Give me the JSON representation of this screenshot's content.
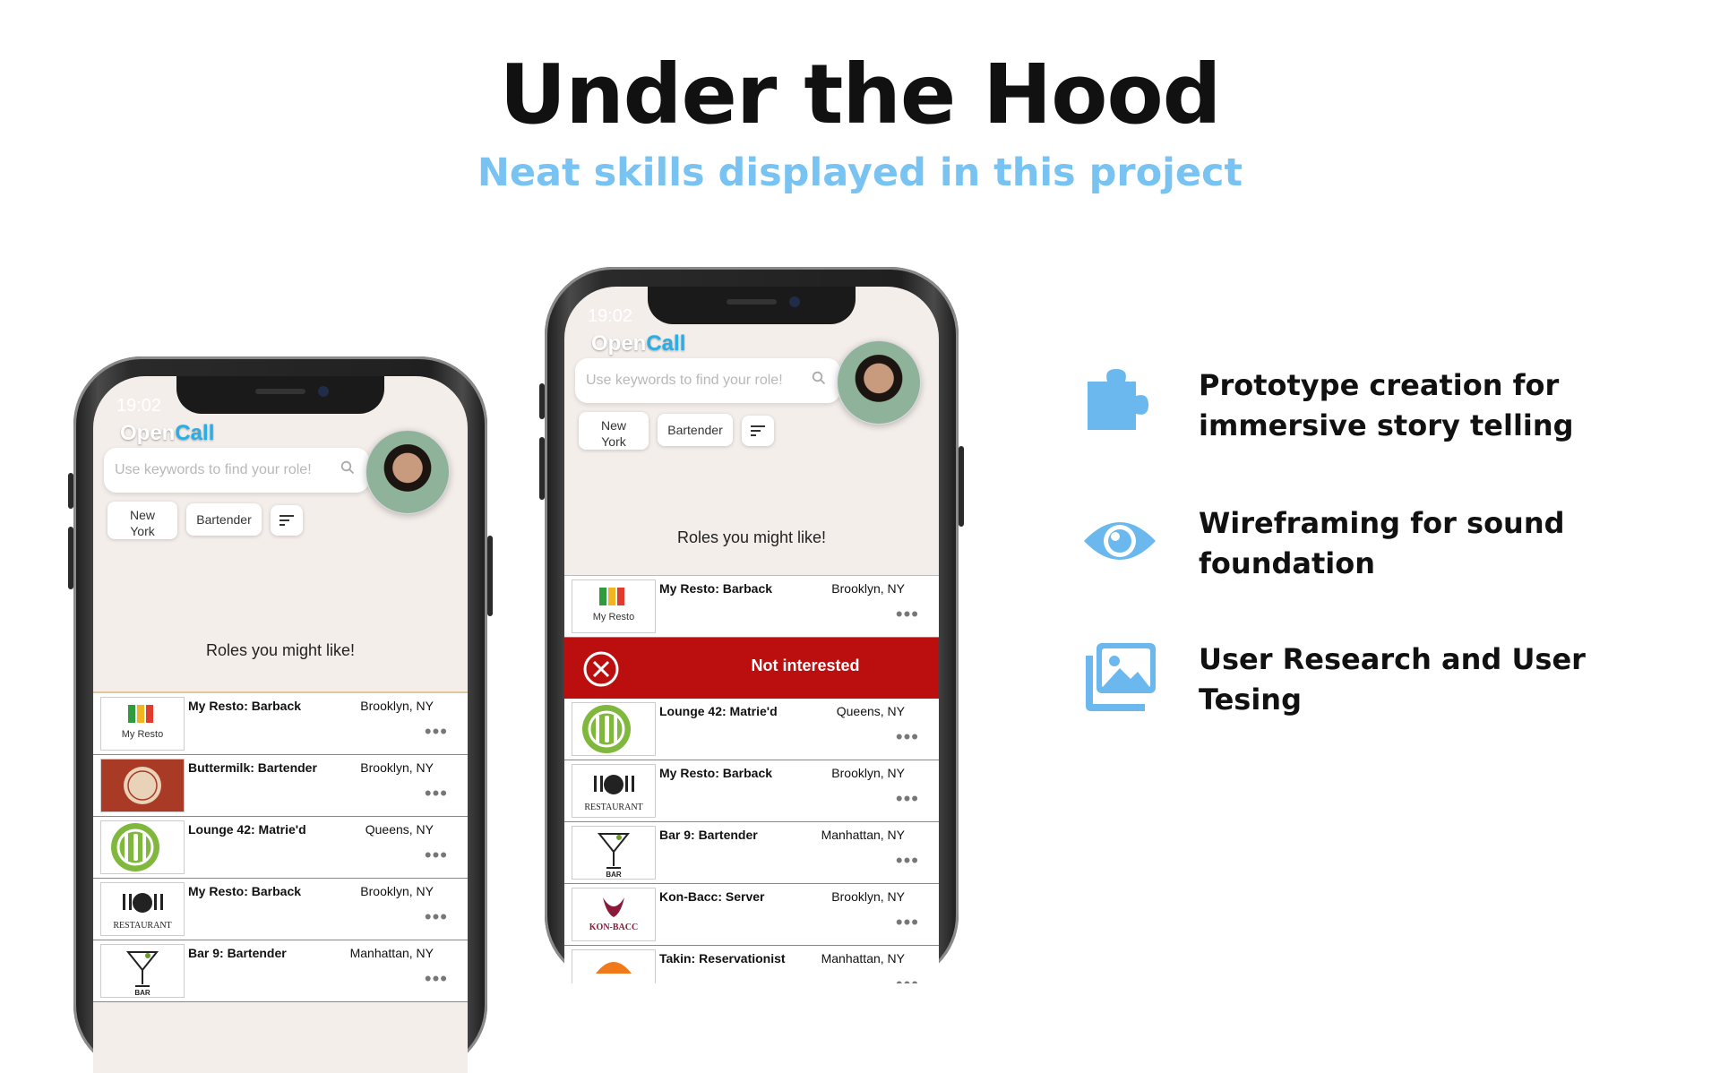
{
  "header": {
    "title": "Under the Hood",
    "subtitle": "Neat skills displayed in this project"
  },
  "app": {
    "time": "19:02",
    "logo_open": "Open",
    "logo_call": "Call",
    "search_placeholder": "Use keywords to find your role!",
    "chip_location": "New York",
    "chip_role": "Bartender",
    "roles_heading": "Roles you might like!",
    "more": "•••",
    "swipe_action": "Not interested"
  },
  "phone_left": {
    "jobs": [
      {
        "title": "My Resto: Barback",
        "location": "Brooklyn, NY"
      },
      {
        "title": "Buttermilk: Bartender",
        "location": "Brooklyn, NY"
      },
      {
        "title": "Lounge 42: Matrie'd",
        "location": "Queens, NY"
      },
      {
        "title": "My Resto: Barback",
        "location": "Brooklyn, NY"
      },
      {
        "title": "Bar 9: Bartender",
        "location": "Manhattan, NY"
      }
    ]
  },
  "phone_right": {
    "jobs": [
      {
        "title": "My Resto: Barback",
        "location": "Brooklyn, NY"
      },
      {
        "title": "Lounge 42: Matrie'd",
        "location": "Queens, NY"
      },
      {
        "title": "My Resto: Barback",
        "location": "Brooklyn, NY"
      },
      {
        "title": "Bar 9: Bartender",
        "location": "Manhattan, NY"
      },
      {
        "title": "Kon-Bacc: Server",
        "location": "Brooklyn, NY"
      },
      {
        "title": "Takin: Reservationist",
        "location": "Manhattan, NY"
      }
    ]
  },
  "logos": {
    "myresto": "My Resto",
    "restaurant": "RESTAURANT",
    "bar": "BAR",
    "konbacc": "KON-BACC"
  },
  "features": [
    {
      "icon": "puzzle-icon",
      "line1": "Prototype creation for",
      "line2": "immersive story telling"
    },
    {
      "icon": "eye-icon",
      "line1": "Wireframing for sound",
      "line2": "foundation"
    },
    {
      "icon": "image-gallery-icon",
      "line1": "User Research and User",
      "line2": "Tesing"
    }
  ],
  "colors": {
    "accent": "#78c3f2",
    "icon": "#6ab8ee",
    "swipe_red": "#bb0e0e",
    "logo_call": "#27aee7",
    "app_bg": "#f4eeeb"
  }
}
